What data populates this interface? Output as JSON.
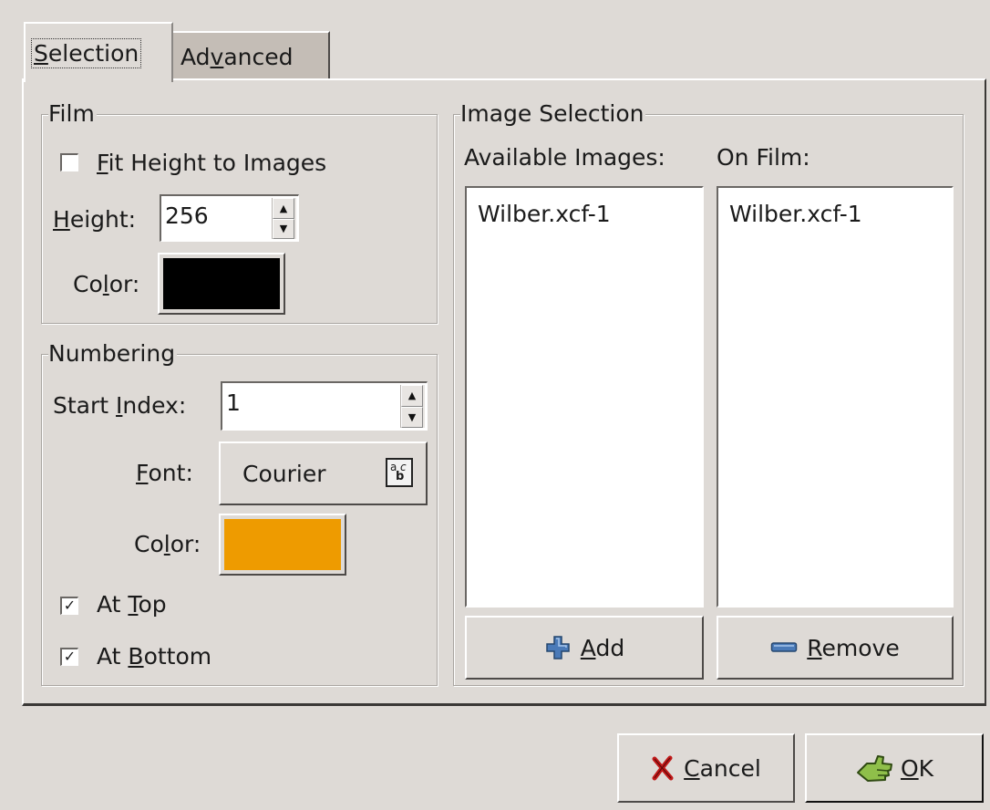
{
  "tabs": {
    "selection": {
      "pre": "",
      "mn": "S",
      "post": "election"
    },
    "advanced": {
      "pre": "Ad",
      "mn": "v",
      "post": "anced"
    }
  },
  "film": {
    "title": "Film",
    "fit_height": {
      "pre": "",
      "mn": "F",
      "post": "it Height to Images",
      "checked": false
    },
    "height_label": {
      "pre": "",
      "mn": "H",
      "post": "eight:"
    },
    "height_value": "256",
    "color_label": {
      "pre": "Co",
      "mn": "l",
      "post": "or:"
    },
    "color": "#000000"
  },
  "numbering": {
    "title": "Numbering",
    "start_index_label": {
      "pre": "Start ",
      "mn": "I",
      "post": "ndex:"
    },
    "start_index_value": "1",
    "font_label": {
      "pre": "",
      "mn": "F",
      "post": "ont:"
    },
    "font_value": "Courier",
    "color_label": {
      "pre": "Co",
      "mn": "l",
      "post": "or:"
    },
    "color": "#ee9b00",
    "at_top": {
      "pre": "At ",
      "mn": "T",
      "post": "op",
      "checked": true
    },
    "at_bottom": {
      "pre": "At ",
      "mn": "B",
      "post": "ottom",
      "checked": true
    }
  },
  "image_selection": {
    "title": "Image Selection",
    "available_label": "Available Images:",
    "on_film_label": "On Film:",
    "available_items": [
      "Wilber.xcf-1"
    ],
    "on_film_items": [
      "Wilber.xcf-1"
    ],
    "add_button": {
      "pre": "",
      "mn": "A",
      "post": "dd"
    },
    "remove_button": {
      "pre": "",
      "mn": "R",
      "post": "emove"
    }
  },
  "dialog": {
    "cancel_button": {
      "pre": "",
      "mn": "C",
      "post": "ancel"
    },
    "ok_button": {
      "pre": "",
      "mn": "O",
      "post": "K"
    }
  },
  "icons": {
    "add": "plus-icon",
    "remove": "minus-icon",
    "cancel": "x-icon",
    "ok": "ok-hand-icon",
    "font": "font-select-icon"
  },
  "colors": {
    "background": "#dedad6",
    "plus": "#4a7ab8",
    "cancel": "#c01818",
    "ok": "#7da63e"
  }
}
